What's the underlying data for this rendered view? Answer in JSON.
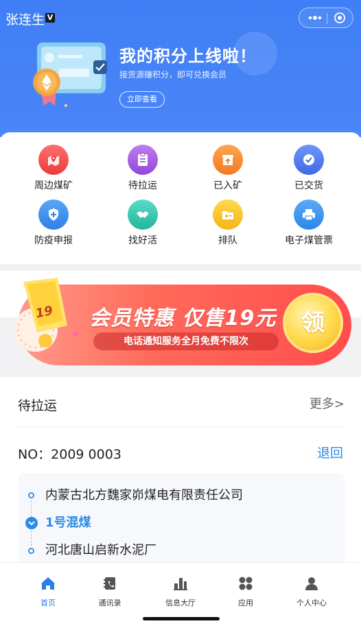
{
  "header": {
    "user_name": "张连生",
    "badge": "V",
    "banner_title": "我的积分上线啦！",
    "banner_subtitle": "接货源赚积分，即可兑换会员",
    "banner_button": "立即查看"
  },
  "grid": [
    {
      "label": "周边煤矿",
      "icon": "map-pin-icon",
      "color": "#f34a4a"
    },
    {
      "label": "待拉运",
      "icon": "clipboard-icon",
      "color": "#a45bdb"
    },
    {
      "label": "已入矿",
      "icon": "box-arrow-up-icon",
      "color": "#f58e35"
    },
    {
      "label": "已交货",
      "icon": "check-circle-icon",
      "color": "#4f7bf0"
    },
    {
      "label": "防疫申报",
      "icon": "shield-plus-icon",
      "color": "#3b8ff0"
    },
    {
      "label": "找好活",
      "icon": "handshake-icon",
      "color": "#36c7b0"
    },
    {
      "label": "排队",
      "icon": "folder-queue-icon",
      "color": "#f5c52c"
    },
    {
      "label": "电子煤管票",
      "icon": "printer-icon",
      "color": "#3a97ee"
    }
  ],
  "promo": {
    "title": "会员特惠 仅售19元",
    "subtitle": "电话通知服务全月免费不限次",
    "coin_text": "领",
    "ticket_text": "19"
  },
  "pending": {
    "title": "待拉运",
    "more": "更多>",
    "order_no": "NO：2009 0003",
    "retract": "退回",
    "origin": "内蒙古北方魏家峁煤电有限责任公司",
    "cargo": "1号混煤",
    "destination": "河北唐山启新水泥厂"
  },
  "tabs": [
    {
      "label": "首页",
      "icon": "home-icon",
      "active": true
    },
    {
      "label": "通讯录",
      "icon": "contacts-icon",
      "active": false
    },
    {
      "label": "信息大厅",
      "icon": "bar-chart-icon",
      "active": false
    },
    {
      "label": "应用",
      "icon": "apps-icon",
      "active": false
    },
    {
      "label": "个人中心",
      "icon": "user-icon",
      "active": false
    }
  ]
}
